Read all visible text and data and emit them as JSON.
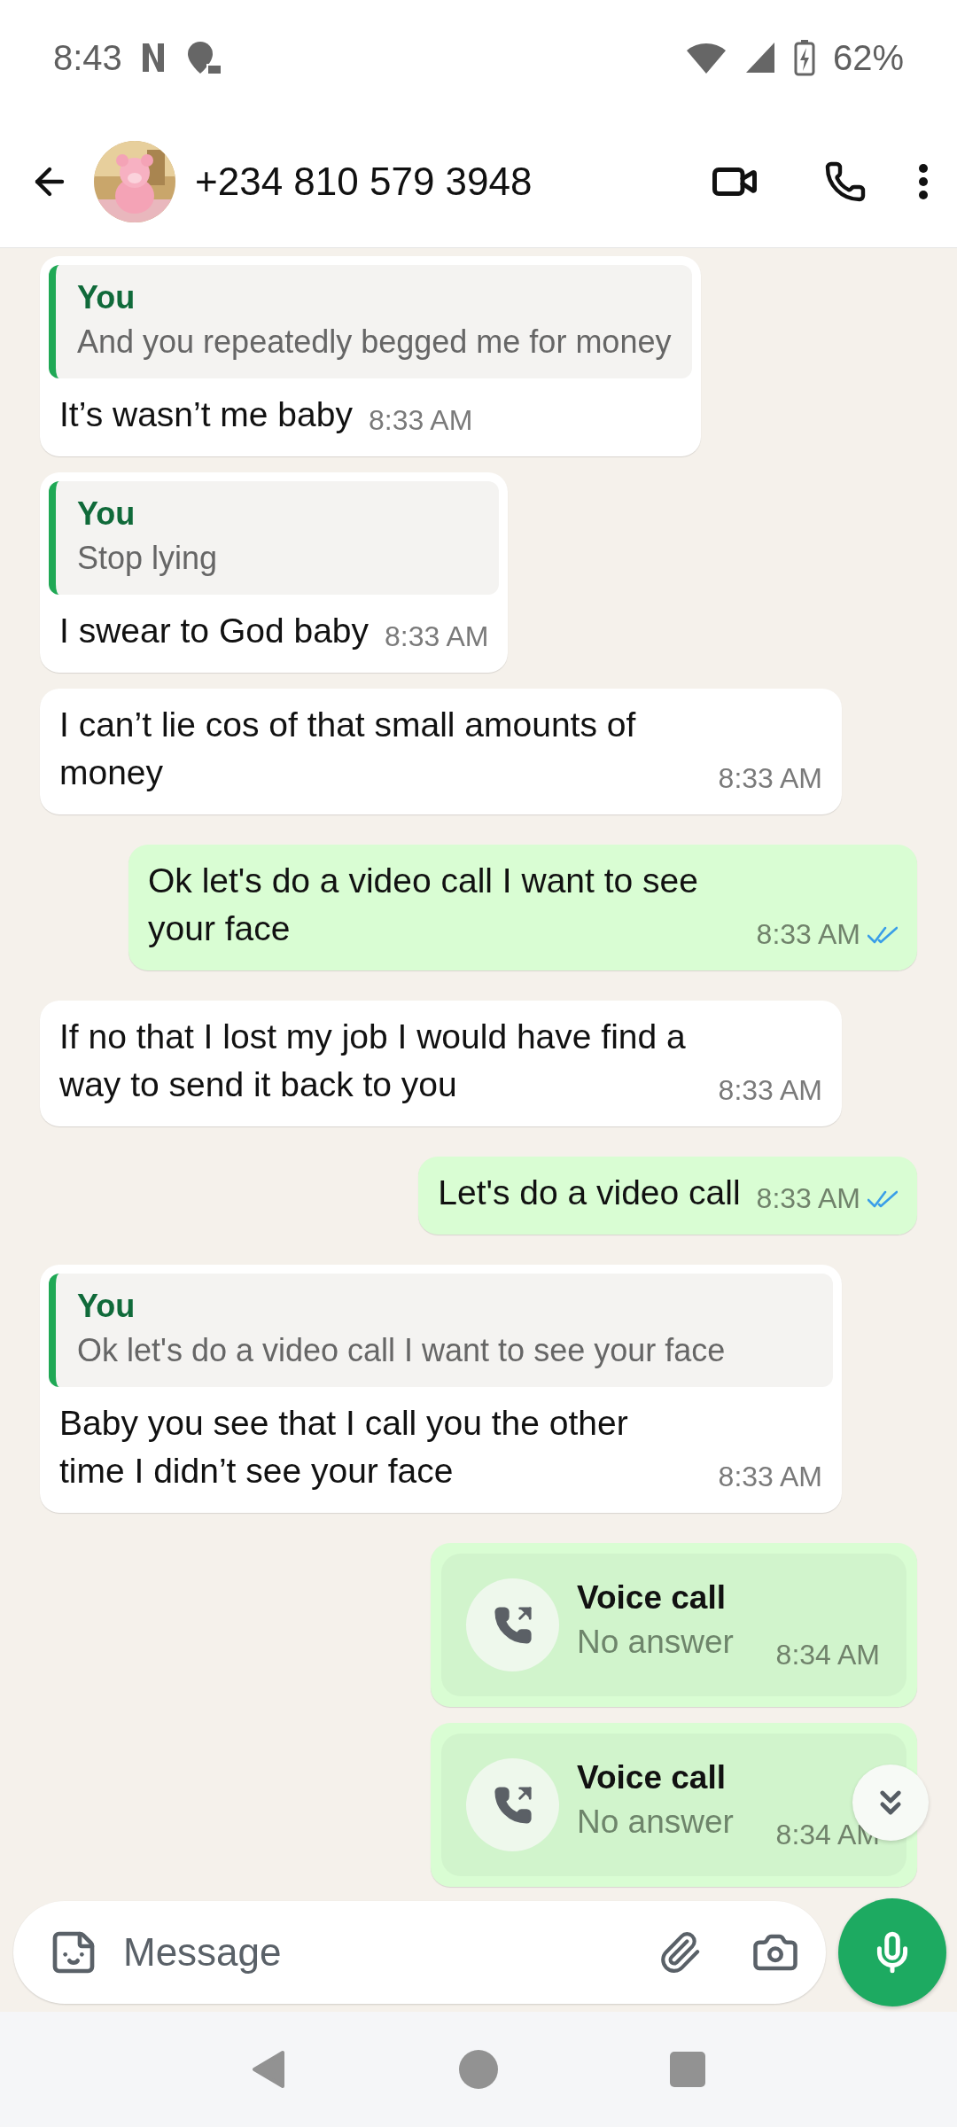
{
  "status_bar": {
    "time": "8:43",
    "battery": "62%"
  },
  "header": {
    "title": "+234 810 579 3948"
  },
  "messages": [
    {
      "kind": "text",
      "outgoing": false,
      "quote": {
        "author": "You",
        "text": "And you repeatedly begged me for money"
      },
      "text": "It’s wasn’t me baby",
      "time": "8:33 AM"
    },
    {
      "kind": "text",
      "outgoing": false,
      "quote": {
        "author": "You",
        "text": "Stop lying"
      },
      "text": "I swear to God baby",
      "time": "8:33 AM"
    },
    {
      "kind": "text",
      "outgoing": false,
      "text": "I can’t lie cos of that small amounts of money",
      "time": "8:33 AM"
    },
    {
      "kind": "text",
      "outgoing": true,
      "read": true,
      "text": "Ok let's do a video call I want to see your face",
      "time": "8:33 AM"
    },
    {
      "kind": "text",
      "outgoing": false,
      "text": "If no that I lost my job I would have find a way to send it back to you",
      "time": "8:33 AM"
    },
    {
      "kind": "text",
      "outgoing": true,
      "read": true,
      "text": "Let's do a video call",
      "time": "8:33 AM"
    },
    {
      "kind": "text",
      "outgoing": false,
      "quote": {
        "author": "You",
        "text": "Ok let's do a video call I want to see your face"
      },
      "text": "Baby you see that I call you the other time I didn’t see your face",
      "time": "8:33 AM"
    },
    {
      "kind": "call",
      "outgoing": true,
      "title": "Voice call",
      "status": "No answer",
      "time": "8:34 AM"
    },
    {
      "kind": "call",
      "outgoing": true,
      "title": "Voice call",
      "status": "No answer",
      "time": "8:34 AM"
    }
  ],
  "composer": {
    "placeholder": "Message"
  }
}
